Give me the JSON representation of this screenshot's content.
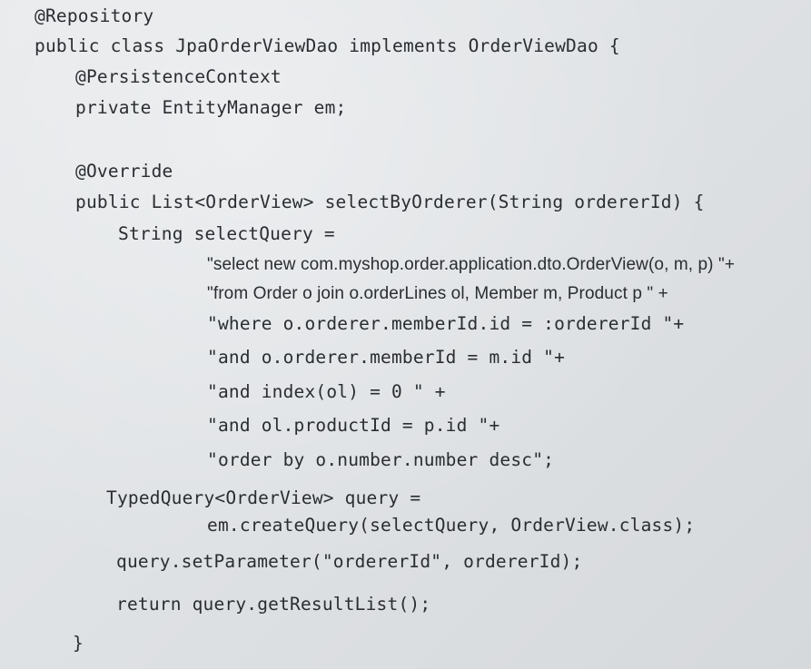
{
  "code": {
    "lines": [
      "@Repository",
      "public class JpaOrderViewDao implements OrderViewDao {",
      "@PersistenceContext",
      "private EntityManager em;",
      "@Override",
      "public List<OrderView> selectByOrderer(String ordererId) {",
      "String selectQuery =",
      "\"select new com.myshop.order.application.dto.OrderView(o, m, p) \"+",
      "\"from Order o join o.orderLines ol, Member m, Product p \" +",
      "\"where o.orderer.memberId.id = :ordererId \"+",
      "\"and o.orderer.memberId = m.id \"+",
      "\"and index(ol) = 0 \" +",
      "\"and ol.productId = p.id \"+",
      "\"order by o.number.number desc\";",
      "TypedQuery<OrderView> query =",
      "em.createQuery(selectQuery, OrderView.class);",
      "query.setParameter(\"ordererId\", ordererId);",
      "return query.getResultList();",
      "}"
    ]
  },
  "colors": {
    "text": "#2a2d31",
    "background": "#e2e5e8"
  }
}
